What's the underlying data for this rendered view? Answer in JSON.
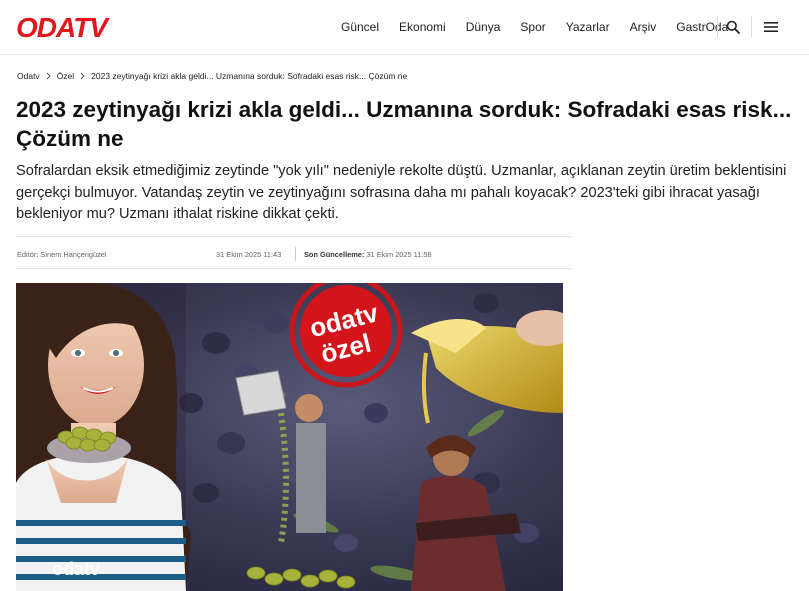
{
  "header": {
    "logo_text": "ODATV",
    "nav": [
      "Güncel",
      "Ekonomi",
      "Dünya",
      "Spor",
      "Yazarlar",
      "Arşiv",
      "GastrOda"
    ],
    "search_icon": "search-icon",
    "menu_icon": "hamburger-menu-icon"
  },
  "breadcrumb": {
    "items": [
      "Odatv",
      "Özel",
      "2023 zeytinyağı krizi akla geldi... Uzmanına sorduk: Sofradaki esas risk... Çözüm ne"
    ]
  },
  "article": {
    "title": "2023 zeytinyağı krizi akla geldi... Uzmanına sorduk: Sofradaki esas risk... Çözüm ne",
    "summary": "Sofralardan eksik etmediğimiz zeytinde \"yok yılı\" nedeniyle rekolte düştü. Uzmanlar, açıklanan zeytin üretim beklentisini gerçekçi bulmuyor. Vatandaş zeytin ve zeytinyağını sofrasına daha mı pahalı koyacak? 2023'teki gibi ihracat yasağı bekleniyor mu? Uzmanı ithalat riskine dikkat çekti.",
    "editor": "Editör: Sinem Hançerigüzel",
    "published": "31 Ekim 2025 11:43",
    "updated_label": "Son Güncelleme:",
    "updated": "31 Ekim 2025 11:58"
  },
  "hero": {
    "stamp_line1": "odatv",
    "stamp_line2": "özel",
    "watermark": "odatv"
  },
  "colors": {
    "brand_red": "#e3161c",
    "text": "#111111",
    "muted": "#666666"
  }
}
